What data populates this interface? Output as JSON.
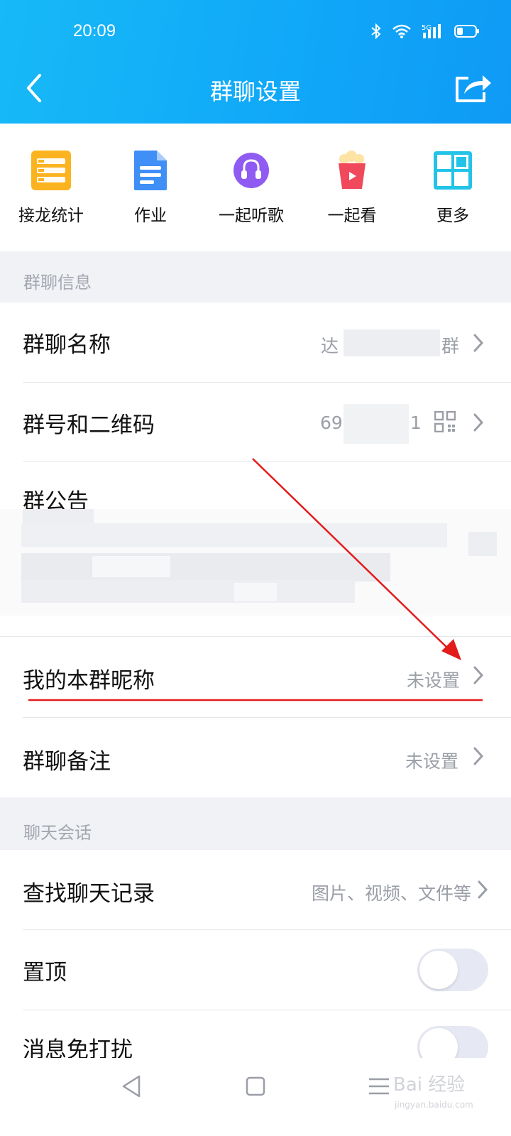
{
  "status": {
    "time": "20:09",
    "network": "5G"
  },
  "header": {
    "title": "群聊设置"
  },
  "apps": [
    {
      "label": "接龙统计",
      "icon": "list-sheet-icon",
      "color": "#fbb31f"
    },
    {
      "label": "作业",
      "icon": "document-icon",
      "color": "#3f8ff7"
    },
    {
      "label": "一起听歌",
      "icon": "earphones-icon",
      "color": "#8f5bf2"
    },
    {
      "label": "一起看",
      "icon": "popcorn-icon",
      "color": "#f0495b"
    },
    {
      "label": "更多",
      "icon": "grid-more-icon",
      "color": "#23c3e8"
    }
  ],
  "section_info": {
    "title": "群聊信息"
  },
  "rows": {
    "group_name": {
      "label": "群聊名称",
      "value_start": "达",
      "value_end": "群"
    },
    "group_number": {
      "label": "群号和二维码",
      "value_start": "69",
      "value_end": "1"
    },
    "announcement": {
      "label": "群公告"
    },
    "my_nickname": {
      "label": "我的本群昵称",
      "value": "未设置"
    },
    "group_remark": {
      "label": "群聊备注",
      "value": "未设置"
    }
  },
  "section_chat": {
    "title": "聊天会话"
  },
  "chat_rows": {
    "search": {
      "label": "查找聊天记录",
      "value": "图片、视频、文件等"
    },
    "pin": {
      "label": "置顶",
      "toggle_on": false
    },
    "mute": {
      "label": "消息免打扰",
      "toggle_on": false
    }
  },
  "watermark": {
    "brand": "Bai 经验",
    "url": "jingyan.baidu.com"
  },
  "annotation_color": "#e31b1b",
  "accent": "#12a9f8"
}
